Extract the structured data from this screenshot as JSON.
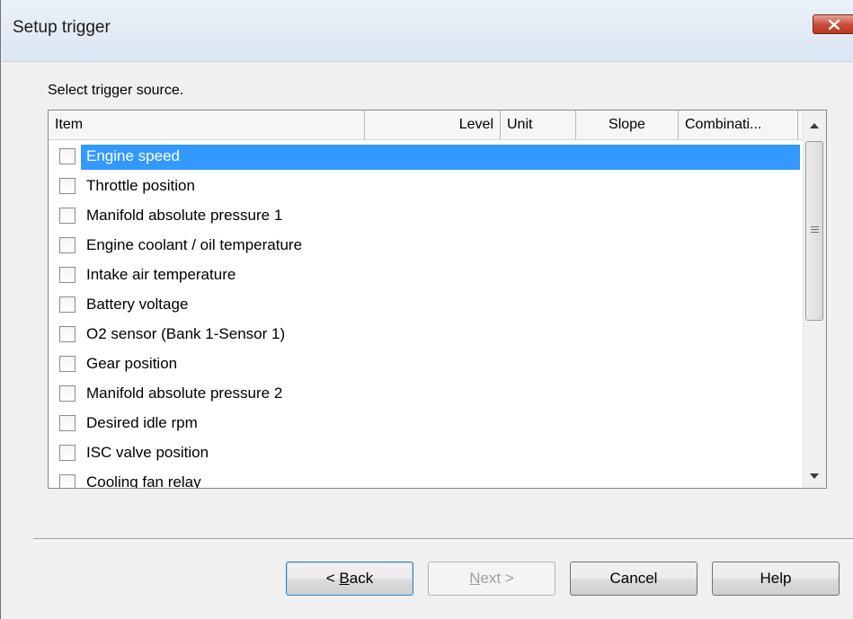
{
  "window": {
    "title": "Setup trigger"
  },
  "prompt": "Select trigger source.",
  "columns": {
    "item": "Item",
    "level": "Level",
    "unit": "Unit",
    "slope": "Slope",
    "combination": "Combinati..."
  },
  "items": [
    {
      "label": "Engine speed",
      "checked": false,
      "selected": true
    },
    {
      "label": "Throttle position",
      "checked": false,
      "selected": false
    },
    {
      "label": "Manifold absolute pressure 1",
      "checked": false,
      "selected": false
    },
    {
      "label": "Engine coolant / oil temperature",
      "checked": false,
      "selected": false
    },
    {
      "label": "Intake air temperature",
      "checked": false,
      "selected": false
    },
    {
      "label": "Battery voltage",
      "checked": false,
      "selected": false
    },
    {
      "label": "O2 sensor (Bank 1-Sensor 1)",
      "checked": false,
      "selected": false
    },
    {
      "label": "Gear position",
      "checked": false,
      "selected": false
    },
    {
      "label": "Manifold absolute pressure 2",
      "checked": false,
      "selected": false
    },
    {
      "label": "Desired idle rpm",
      "checked": false,
      "selected": false
    },
    {
      "label": "ISC valve position",
      "checked": false,
      "selected": false
    },
    {
      "label": "Cooling fan relay",
      "checked": false,
      "selected": false
    }
  ],
  "buttons": {
    "back": "< Back",
    "next": "Next >",
    "cancel": "Cancel",
    "help": "Help"
  },
  "colors": {
    "selection": "#3399ff",
    "close_button": "#c94a37"
  }
}
